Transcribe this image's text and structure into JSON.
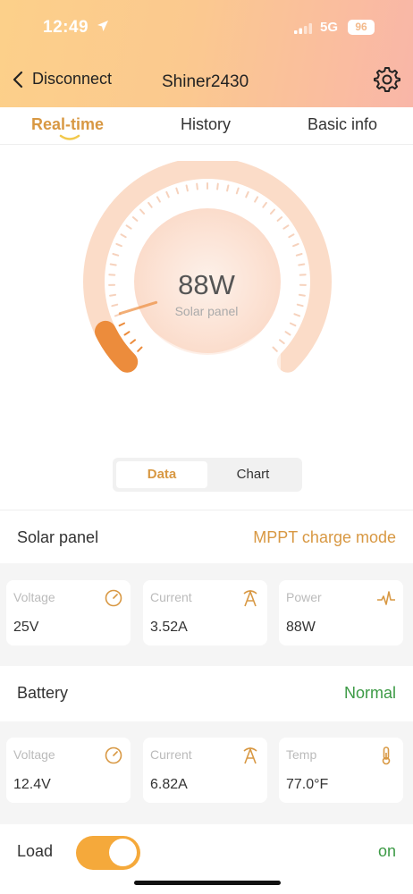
{
  "status_bar": {
    "time": "12:49",
    "network": "5G",
    "battery": "96"
  },
  "nav": {
    "back_label": "Disconnect",
    "title": "Shiner2430"
  },
  "tabs": [
    {
      "label": "Real-time",
      "active": true
    },
    {
      "label": "History",
      "active": false
    },
    {
      "label": "Basic info",
      "active": false
    }
  ],
  "gauge": {
    "value": "88W",
    "label": "Solar panel",
    "level_fraction": 0.07
  },
  "view_toggle": {
    "data_label": "Data",
    "chart_label": "Chart",
    "selected": "Data"
  },
  "solar": {
    "title": "Solar panel",
    "mode": "MPPT charge mode",
    "cards": [
      {
        "label": "Voltage",
        "value": "25V",
        "icon": "gauge-icon"
      },
      {
        "label": "Current",
        "value": "3.52A",
        "icon": "current-icon"
      },
      {
        "label": "Power",
        "value": "88W",
        "icon": "pulse-icon"
      }
    ]
  },
  "battery": {
    "title": "Battery",
    "status": "Normal",
    "cards": [
      {
        "label": "Voltage",
        "value": "12.4V",
        "icon": "gauge-icon"
      },
      {
        "label": "Current",
        "value": "6.82A",
        "icon": "current-icon"
      },
      {
        "label": "Temp",
        "value": "77.0°F",
        "icon": "thermometer-icon"
      }
    ]
  },
  "load": {
    "label": "Load",
    "state": "on",
    "enabled": true
  },
  "colors": {
    "accent": "#d89843",
    "toggle": "#f5a93b",
    "status_green": "#3c9a45"
  }
}
